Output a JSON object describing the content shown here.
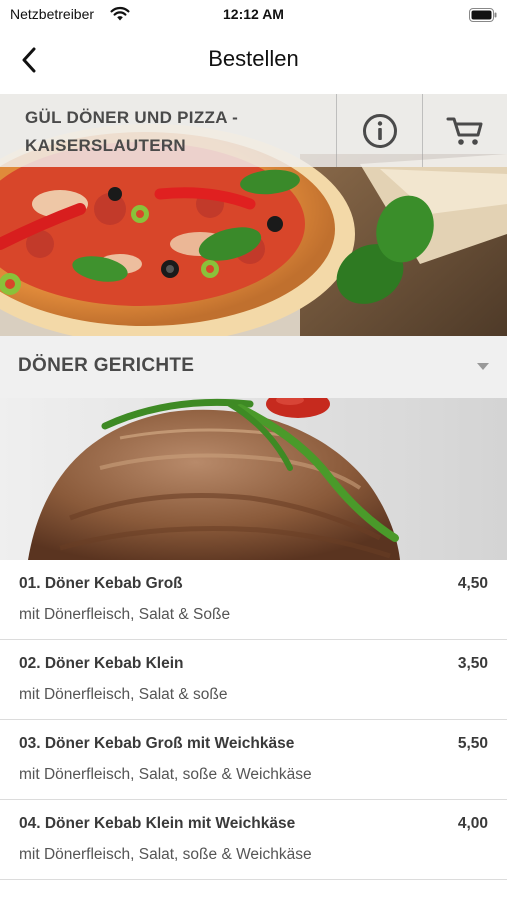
{
  "status_bar": {
    "carrier": "Netzbetreiber",
    "time": "12:12 AM"
  },
  "nav": {
    "title": "Bestellen"
  },
  "restaurant": {
    "name": "GÜL DÖNER UND PIZZA - KAISERSLAUTERN"
  },
  "category": {
    "title": "DÖNER GERICHTE"
  },
  "menu_items": [
    {
      "name": "01. Döner Kebab Groß",
      "price": "4,50",
      "description": "mit Dönerfleisch, Salat & Soße"
    },
    {
      "name": "02. Döner Kebab Klein",
      "price": "3,50",
      "description": "mit Dönerfleisch, Salat & soße"
    },
    {
      "name": "03. Döner Kebab Groß mit Weichkäse",
      "price": "5,50",
      "description": "mit Dönerfleisch, Salat, soße & Weichkäse"
    },
    {
      "name": "04. Döner Kebab Klein mit Weichkäse",
      "price": "4,00",
      "description": "mit Dönerfleisch, Salat, soße & Weichkäse"
    }
  ],
  "icons": {
    "back": "chevron-left-icon",
    "info": "info-icon",
    "cart": "cart-icon",
    "expand": "chevron-down-icon"
  },
  "colors": {
    "header_text": "#4a4a4a",
    "category_bg": "#f0f0f0",
    "divider": "#dcdcdc"
  }
}
